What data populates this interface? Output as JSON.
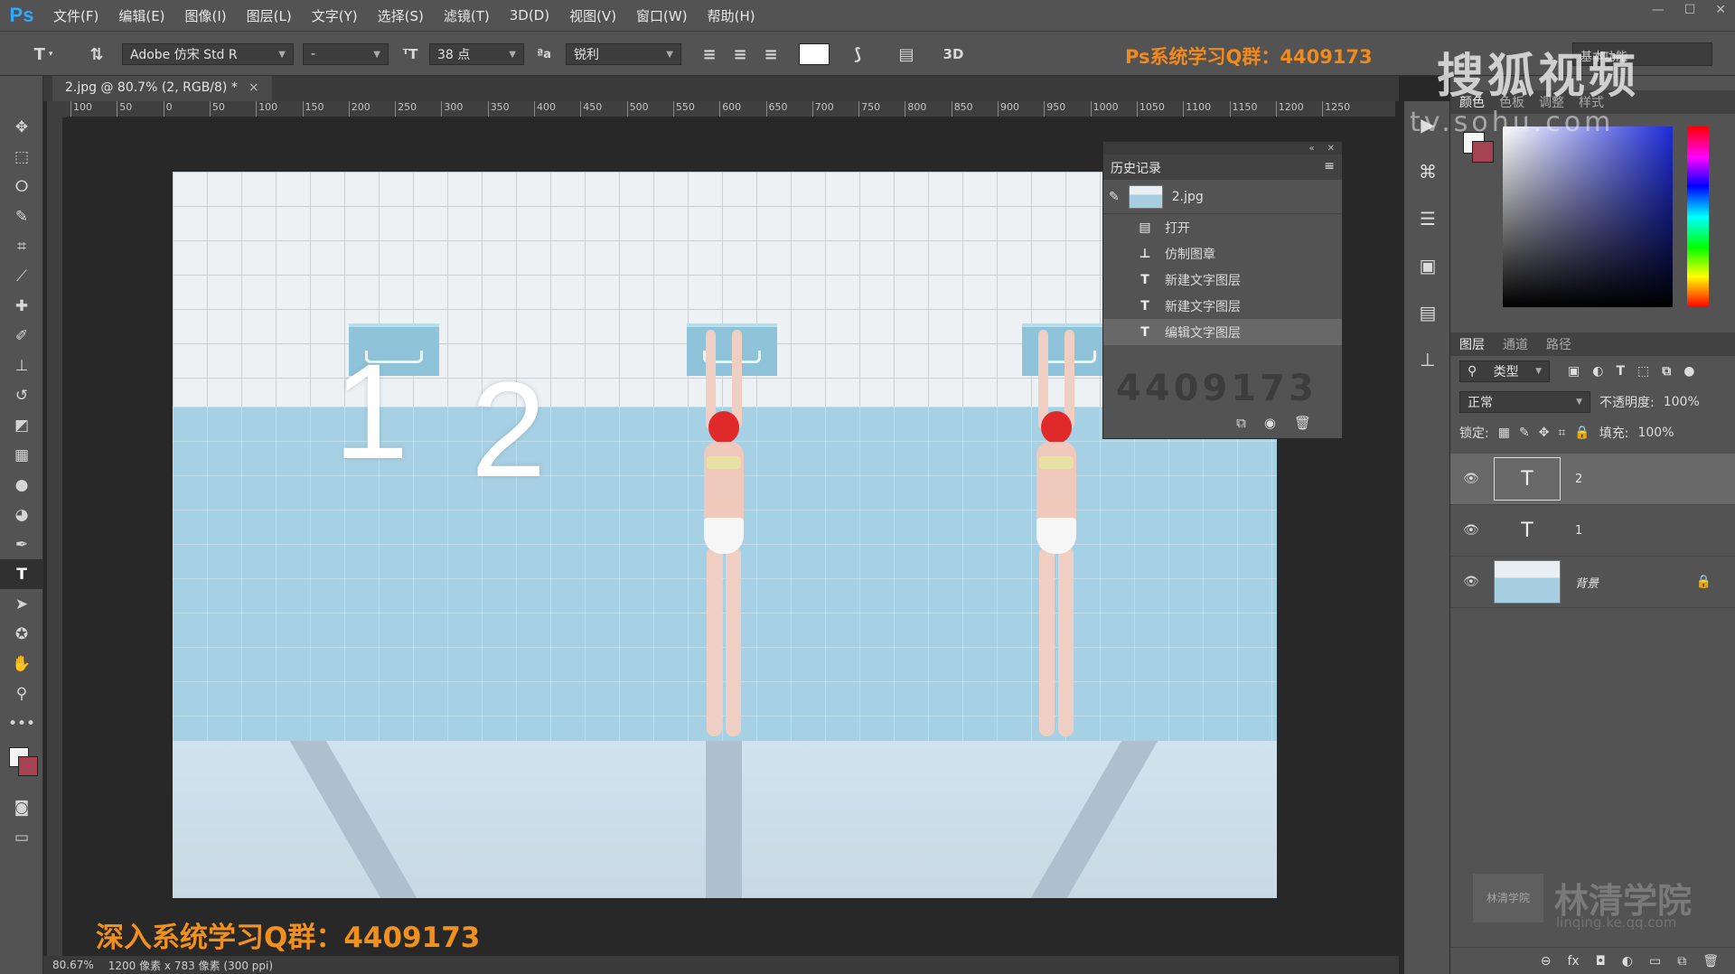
{
  "app": {
    "logo": "Ps"
  },
  "menu": [
    "文件(F)",
    "编辑(E)",
    "图像(I)",
    "图层(L)",
    "文字(Y)",
    "选择(S)",
    "滤镜(T)",
    "3D(D)",
    "视图(V)",
    "窗口(W)",
    "帮助(H)"
  ],
  "window_controls": [
    "—",
    "☐",
    "✕"
  ],
  "options": {
    "type_tool_icon": "T",
    "font_family": "Adobe 仿宋 Std R",
    "font_style": "-",
    "font_size": "38 点",
    "aa_label": "ªa",
    "antialias": "锐利",
    "color": "#ffffff",
    "three_d": "3D"
  },
  "watermarks": {
    "qq_top": "Ps系统学习Q群：4409173",
    "sohu": "搜狐视频",
    "sohu_url": "tv.sohu.com",
    "qq_bottom": "深入系统学习Q群：4409173",
    "history_bg_number": "4409173",
    "linqing_badge": "林清学院",
    "linqing_name": "林清学院",
    "linqing_url": "linqing.ke.qq.com"
  },
  "workspace_label": "基本功能",
  "document": {
    "tab_title": "2.jpg @ 80.7% (2, RGB/8) *",
    "close": "×",
    "ruler_ticks": [
      "100",
      "50",
      "0",
      "50",
      "100",
      "150",
      "200",
      "250",
      "300",
      "350",
      "400",
      "450",
      "500",
      "550",
      "600",
      "650",
      "700",
      "750",
      "800",
      "850",
      "900",
      "950",
      "1000",
      "1050",
      "1100",
      "1150",
      "1200",
      "1250"
    ],
    "canvas_texts": [
      "1",
      "2"
    ]
  },
  "status": {
    "zoom": "80.67%",
    "info": "1200 像素 x 783 像素 (300 ppi)"
  },
  "history": {
    "title": "历史记录",
    "snapshot": "2.jpg",
    "steps": [
      {
        "label": "打开",
        "icon": "▤"
      },
      {
        "label": "仿制图章",
        "icon": "⊥"
      },
      {
        "label": "新建文字图层",
        "icon": "T"
      },
      {
        "label": "新建文字图层",
        "icon": "T"
      },
      {
        "label": "编辑文字图层",
        "icon": "T"
      }
    ]
  },
  "color_panel": {
    "tabs": [
      "颜色",
      "色板",
      "调整",
      "样式"
    ],
    "fg": "#f5f5f5",
    "bg": "#a54353"
  },
  "layers_panel": {
    "tabs": [
      "图层",
      "通道",
      "路径"
    ],
    "filter_kind": "类型",
    "blend_mode": "正常",
    "opacity_label": "不透明度:",
    "opacity": "100%",
    "lock_label": "锁定:",
    "fill_label": "填充:",
    "fill": "100%",
    "layers": [
      {
        "name": "2",
        "type": "text",
        "selected": true
      },
      {
        "name": "1",
        "type": "text",
        "selected": false
      },
      {
        "name": "背景",
        "type": "image",
        "selected": false,
        "locked": true
      }
    ],
    "footer_icons": [
      "⊖",
      "fx",
      "◘",
      "◐",
      "▭",
      "⧉",
      "🗑"
    ]
  }
}
